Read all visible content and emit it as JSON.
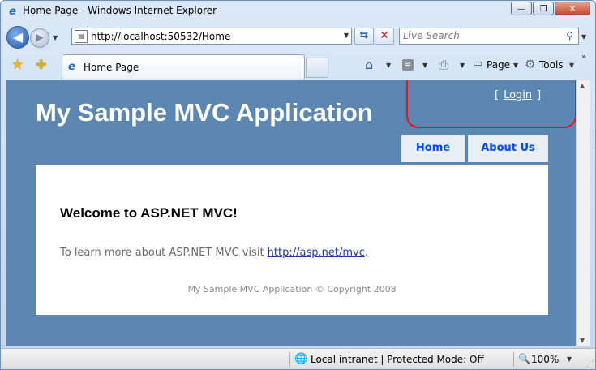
{
  "window": {
    "title": "Home Page - Windows Internet Explorer",
    "minimize_glyph": "—",
    "maximize_glyph": "❐",
    "close_glyph": "✕"
  },
  "navbar": {
    "address": "http://localhost:50532/Home",
    "search_placeholder": "Live Search"
  },
  "tabs": [
    {
      "label": "Home Page"
    }
  ],
  "commandbar": {
    "page_label": "Page",
    "tools_label": "Tools"
  },
  "site": {
    "title": "My Sample MVC Application",
    "login_open": "[",
    "login_label": "Login",
    "login_close": "]",
    "menu": [
      {
        "label": "Home"
      },
      {
        "label": "About Us"
      }
    ],
    "heading": "Welcome to ASP.NET MVC!",
    "learn_prefix": "To learn more about ASP.NET MVC visit ",
    "learn_link": "http://asp.net/mvc",
    "learn_suffix": ".",
    "footer": "My Sample MVC Application © Copyright 2008"
  },
  "statusbar": {
    "zone": "Local intranet | Protected Mode: Off",
    "zoom": "100%"
  },
  "colors": {
    "page_background": "#5c87b2",
    "highlight": "#e2141b",
    "menu_text": "#034af3"
  }
}
